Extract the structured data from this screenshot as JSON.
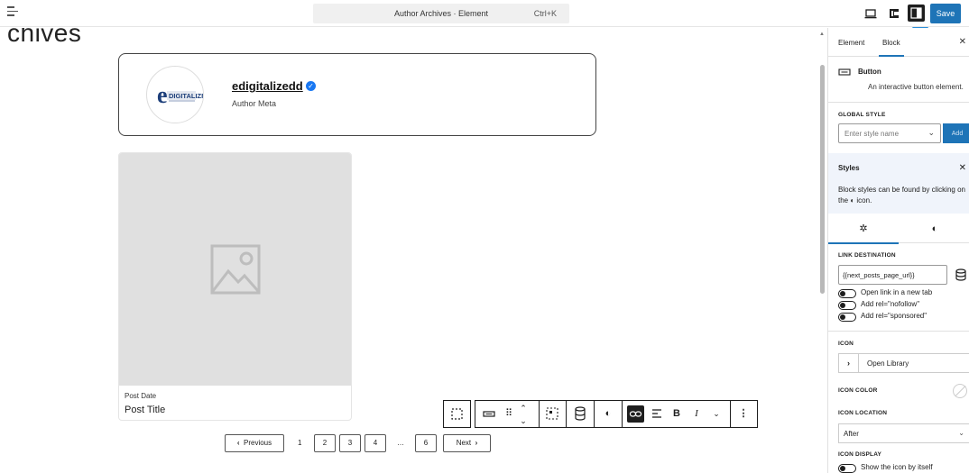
{
  "topbar": {
    "document_title": "Author Archives · Element",
    "shortcut": "Ctrl+K",
    "save_label": "Save"
  },
  "canvas": {
    "archives_title": "chives",
    "author": {
      "name": "edigitalizedd",
      "meta": "Author Meta",
      "logo_text": "DIGITALIZED"
    },
    "post": {
      "date_label": "Post Date",
      "title_label": "Post Title"
    },
    "pagination": {
      "previous": "Previous",
      "next": "Next",
      "pages": [
        "1",
        "2",
        "3",
        "4",
        "…",
        "6"
      ]
    }
  },
  "sidebar": {
    "tabs": [
      "Element",
      "Block"
    ],
    "active_tab": "Block",
    "block_name": "Button",
    "block_description": "An interactive button element.",
    "global_style": {
      "label": "GLOBAL STYLE",
      "placeholder": "Enter style name",
      "add_label": "Add"
    },
    "styles": {
      "title": "Styles",
      "text": "Block styles can be found by clicking on the ◐ icon."
    },
    "link_destination": {
      "label": "LINK DESTINATION",
      "value": "{{next_posts_page_url}}",
      "toggles": [
        "Open link in a new tab",
        "Add rel=\"nofollow\"",
        "Add rel=\"sponsored\""
      ]
    },
    "icon": {
      "label": "ICON",
      "open_library": "Open Library"
    },
    "icon_color": {
      "label": "ICON COLOR"
    },
    "icon_location": {
      "label": "ICON LOCATION",
      "value": "After"
    },
    "icon_display": {
      "label": "ICON DISPLAY",
      "toggle": "Show the icon by itself"
    }
  },
  "colors": {
    "accent": "#1e74b7",
    "placeholder_gray": "#e0e0e0",
    "styles_panel_bg": "#f0f4fb"
  }
}
